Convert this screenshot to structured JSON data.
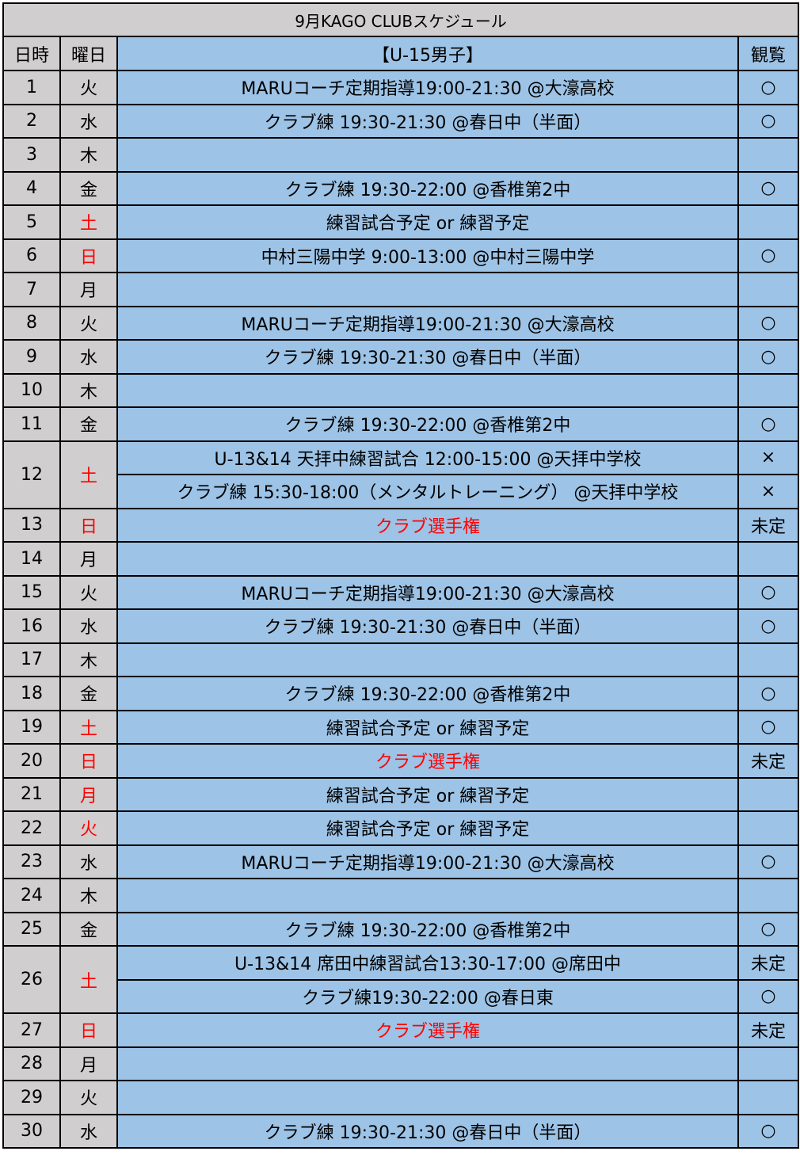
{
  "title": "9月KAGO CLUBスケジュール",
  "headers": {
    "date": "日時",
    "weekday": "曜日",
    "team": "【U-15男子】",
    "view": "観覧"
  },
  "colors": {
    "cell_gray": "#d0cece",
    "cell_blue": "#9dc3e6",
    "holiday_red": "#ff0000",
    "border": "#000000"
  },
  "rows": [
    {
      "day": "1",
      "weekday": "火",
      "events": [
        {
          "text": "MARUコーチ定期指導19:00-21:30 @大濠高校",
          "view": "○"
        }
      ]
    },
    {
      "day": "2",
      "weekday": "水",
      "events": [
        {
          "text": "クラブ練 19:30-21:30 @春日中（半面）",
          "view": "○"
        }
      ]
    },
    {
      "day": "3",
      "weekday": "木",
      "events": [
        {
          "text": "",
          "view": ""
        }
      ]
    },
    {
      "day": "4",
      "weekday": "金",
      "events": [
        {
          "text": "クラブ練 19:30-22:00 @香椎第2中",
          "view": "○"
        }
      ]
    },
    {
      "day": "5",
      "weekday": "土",
      "weekday_red": true,
      "events": [
        {
          "text": "練習試合予定 or 練習予定",
          "view": ""
        }
      ]
    },
    {
      "day": "6",
      "weekday": "日",
      "weekday_red": true,
      "events": [
        {
          "text": "中村三陽中学 9:00-13:00 @中村三陽中学",
          "view": "○"
        }
      ]
    },
    {
      "day": "7",
      "weekday": "月",
      "events": [
        {
          "text": "",
          "view": ""
        }
      ]
    },
    {
      "day": "8",
      "weekday": "火",
      "events": [
        {
          "text": "MARUコーチ定期指導19:00-21:30 @大濠高校",
          "view": "○"
        }
      ]
    },
    {
      "day": "9",
      "weekday": "水",
      "events": [
        {
          "text": "クラブ練 19:30-21:30 @春日中（半面）",
          "view": "○"
        }
      ]
    },
    {
      "day": "10",
      "weekday": "木",
      "events": [
        {
          "text": "",
          "view": ""
        }
      ]
    },
    {
      "day": "11",
      "weekday": "金",
      "events": [
        {
          "text": "クラブ練 19:30-22:00 @香椎第2中",
          "view": "○"
        }
      ]
    },
    {
      "day": "12",
      "weekday": "土",
      "weekday_red": true,
      "events": [
        {
          "text": "U-13&14 天拝中練習試合 12:00-15:00 @天拝中学校",
          "view": "×"
        },
        {
          "text": "クラブ練 15:30-18:00（メンタルトレーニング） @天拝中学校",
          "view": "×"
        }
      ]
    },
    {
      "day": "13",
      "weekday": "日",
      "weekday_red": true,
      "events": [
        {
          "text": "クラブ選手権",
          "text_red": true,
          "view": "未定"
        }
      ]
    },
    {
      "day": "14",
      "weekday": "月",
      "events": [
        {
          "text": "",
          "view": ""
        }
      ]
    },
    {
      "day": "15",
      "weekday": "火",
      "events": [
        {
          "text": "MARUコーチ定期指導19:00-21:30 @大濠高校",
          "view": "○"
        }
      ]
    },
    {
      "day": "16",
      "weekday": "水",
      "events": [
        {
          "text": "クラブ練 19:30-21:30 @春日中（半面）",
          "view": "○"
        }
      ]
    },
    {
      "day": "17",
      "weekday": "木",
      "events": [
        {
          "text": "",
          "view": ""
        }
      ]
    },
    {
      "day": "18",
      "weekday": "金",
      "events": [
        {
          "text": "クラブ練 19:30-22:00 @香椎第2中",
          "view": "○"
        }
      ]
    },
    {
      "day": "19",
      "weekday": "土",
      "weekday_red": true,
      "events": [
        {
          "text": "練習試合予定 or 練習予定",
          "view": "○"
        }
      ]
    },
    {
      "day": "20",
      "weekday": "日",
      "weekday_red": true,
      "events": [
        {
          "text": "クラブ選手権",
          "text_red": true,
          "view": "未定"
        }
      ]
    },
    {
      "day": "21",
      "weekday": "月",
      "weekday_red": true,
      "events": [
        {
          "text": "練習試合予定 or 練習予定",
          "view": ""
        }
      ]
    },
    {
      "day": "22",
      "weekday": "火",
      "weekday_red": true,
      "events": [
        {
          "text": "練習試合予定 or 練習予定",
          "view": ""
        }
      ]
    },
    {
      "day": "23",
      "weekday": "水",
      "events": [
        {
          "text": "MARUコーチ定期指導19:00-21:30 @大濠高校",
          "view": "○"
        }
      ]
    },
    {
      "day": "24",
      "weekday": "木",
      "events": [
        {
          "text": "",
          "view": ""
        }
      ]
    },
    {
      "day": "25",
      "weekday": "金",
      "events": [
        {
          "text": "クラブ練 19:30-22:00 @香椎第2中",
          "view": "○"
        }
      ]
    },
    {
      "day": "26",
      "weekday": "土",
      "weekday_red": true,
      "events": [
        {
          "text": "U-13&14 席田中練習試合13:30-17:00 @席田中",
          "view": "未定"
        },
        {
          "text": "クラブ練19:30-22:00 @春日東",
          "view": "○"
        }
      ]
    },
    {
      "day": "27",
      "weekday": "日",
      "weekday_red": true,
      "events": [
        {
          "text": "クラブ選手権",
          "text_red": true,
          "view": "未定"
        }
      ]
    },
    {
      "day": "28",
      "weekday": "月",
      "events": [
        {
          "text": "",
          "view": ""
        }
      ]
    },
    {
      "day": "29",
      "weekday": "火",
      "events": [
        {
          "text": "",
          "view": ""
        }
      ]
    },
    {
      "day": "30",
      "weekday": "水",
      "events": [
        {
          "text": "クラブ練 19:30-21:30 @春日中（半面）",
          "view": "○"
        }
      ]
    }
  ]
}
